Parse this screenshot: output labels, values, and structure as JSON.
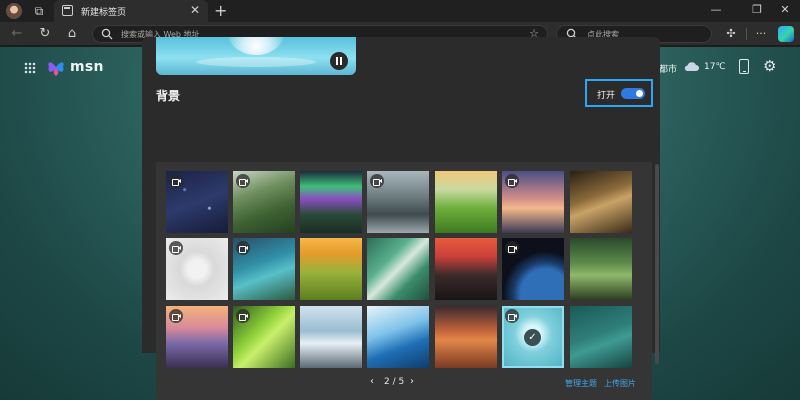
{
  "tabs": [
    {
      "title": "新建标签页",
      "active": true
    }
  ],
  "toolbar": {
    "address_placeholder": "搜索或输入 Web 地址",
    "search_placeholder": "点此搜索"
  },
  "msn": {
    "brand": "msn"
  },
  "weather": {
    "city": "成都市",
    "temp": "17℃",
    "condition_icon": "cloud-icon"
  },
  "panel": {
    "section_title": "背景",
    "toggle": {
      "label": "打开",
      "on": true
    },
    "pager": {
      "text": "2 / 5",
      "current": 2,
      "total": 5
    },
    "links": {
      "manage": "管理主题",
      "upload": "上传图片"
    }
  },
  "wallpapers": [
    {
      "id": "starry-night",
      "video": true,
      "selected": false
    },
    {
      "id": "green-mountains",
      "video": true,
      "selected": false
    },
    {
      "id": "aurora-mountain",
      "video": false,
      "selected": false
    },
    {
      "id": "misty-cliffs",
      "video": true,
      "selected": false
    },
    {
      "id": "green-hills-sunrise",
      "video": false,
      "selected": false
    },
    {
      "id": "coastal-sunset",
      "video": true,
      "selected": false
    },
    {
      "id": "giraffes",
      "video": false,
      "selected": false
    },
    {
      "id": "white-abstract",
      "video": true,
      "selected": false
    },
    {
      "id": "tropical-lagoon",
      "video": true,
      "selected": false
    },
    {
      "id": "golden-valley",
      "video": false,
      "selected": false
    },
    {
      "id": "aerial-river",
      "video": false,
      "selected": false
    },
    {
      "id": "red-sky-coast",
      "video": false,
      "selected": false
    },
    {
      "id": "earth-from-space",
      "video": true,
      "selected": false
    },
    {
      "id": "forest-path",
      "video": false,
      "selected": false
    },
    {
      "id": "pier-sunset",
      "video": true,
      "selected": false
    },
    {
      "id": "ladybug-leaf",
      "video": true,
      "selected": false
    },
    {
      "id": "rocky-shore",
      "video": false,
      "selected": false
    },
    {
      "id": "glacier",
      "video": false,
      "selected": false
    },
    {
      "id": "desert-dunes",
      "video": false,
      "selected": false
    },
    {
      "id": "water-bubble",
      "video": true,
      "selected": true
    },
    {
      "id": "ocean-waves",
      "video": false,
      "selected": false
    }
  ],
  "colors": {
    "accent": "#2d7be0",
    "highlight_border": "#2aa7f5",
    "link": "#43a6f0"
  }
}
